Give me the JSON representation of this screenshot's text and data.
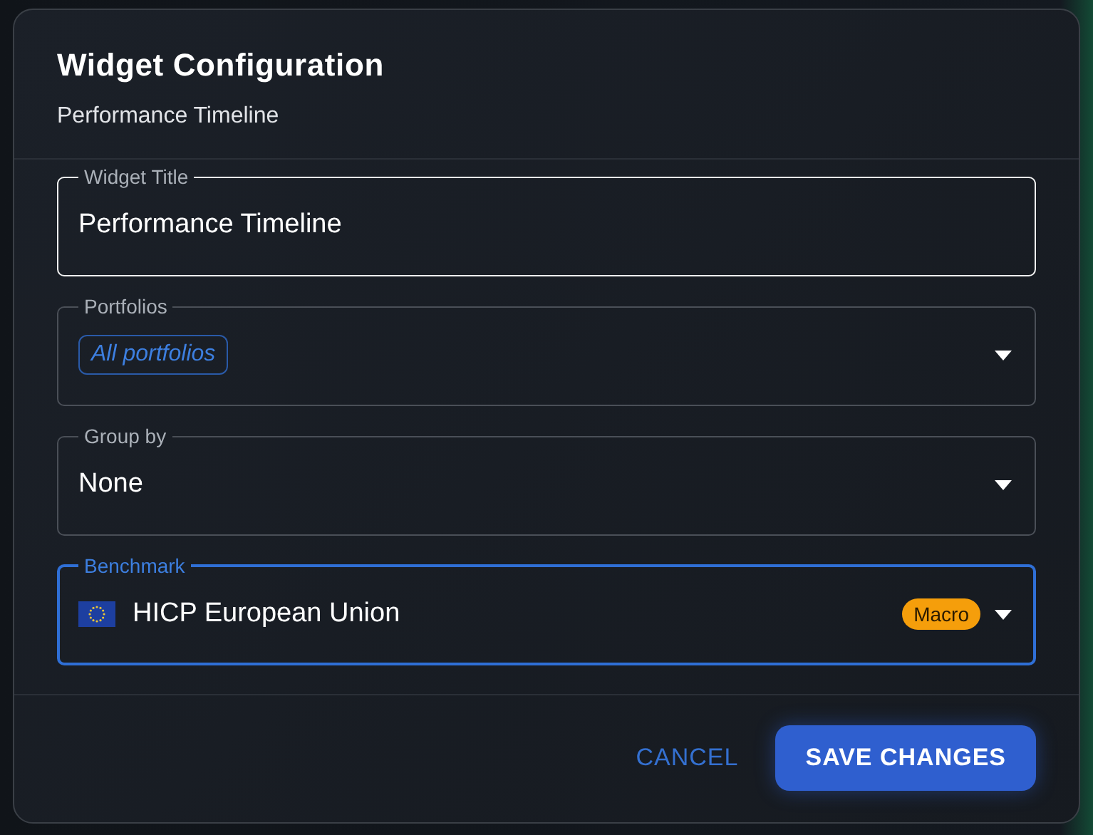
{
  "dialog": {
    "title": "Widget Configuration",
    "subtitle": "Performance Timeline"
  },
  "fields": [
    {
      "kind": "text",
      "label": "Widget Title",
      "value": "Performance Timeline",
      "hovered": true,
      "focused": false
    },
    {
      "kind": "chips",
      "label": "Portfolios",
      "chips": [
        "All portfolios"
      ],
      "hovered": false,
      "focused": false
    },
    {
      "kind": "select",
      "label": "Group by",
      "value": "None",
      "hovered": false,
      "focused": false
    },
    {
      "kind": "flag-select",
      "label": "Benchmark",
      "value": "HICP European Union",
      "badge": {
        "label": "Macro",
        "color": "#f59e0b"
      },
      "hovered": false,
      "focused": true
    }
  ],
  "buttons": [
    {
      "kind": "text",
      "label": "CANCEL"
    },
    {
      "kind": "primary",
      "label": "SAVE CHANGES"
    }
  ]
}
